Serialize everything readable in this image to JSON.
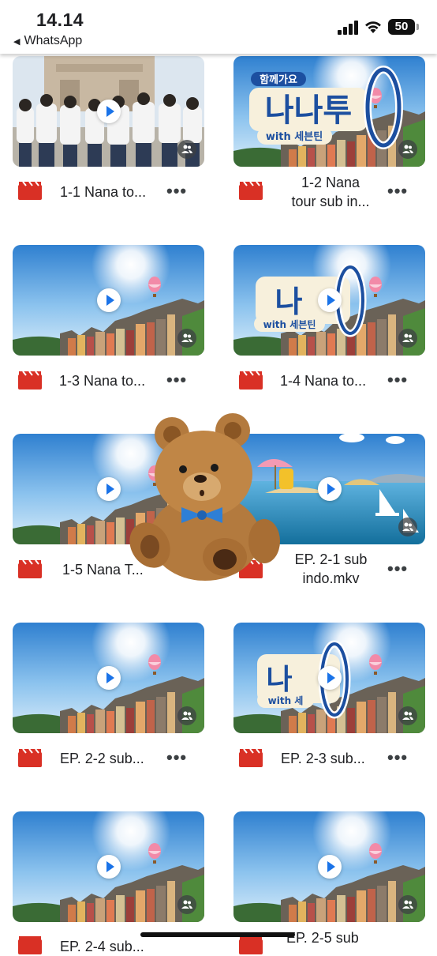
{
  "status_bar": {
    "time": "14.14",
    "back_app": "WhatsApp",
    "battery": "50"
  },
  "files": [
    {
      "name": "1-1 Nana to...",
      "thumb": "group-photo"
    },
    {
      "name": "1-2 Nana tour sub in...",
      "name_line1": "1-2 Nana",
      "name_line2": "tour sub in...",
      "thumb": "logo-full"
    },
    {
      "name": "1-3 Nana to...",
      "thumb": "sky"
    },
    {
      "name": "1-4 Nana to...",
      "thumb": "logo-partial"
    },
    {
      "name": "1-5 Nana T...",
      "thumb": "sky"
    },
    {
      "name": "EP. 2-1 sub indo.mkv",
      "name_line1": "EP. 2-1 sub",
      "name_line2": "indo.mkv",
      "thumb": "sea"
    },
    {
      "name": "EP. 2-2 sub...",
      "thumb": "sky"
    },
    {
      "name": "EP. 2-3 sub...",
      "thumb": "logo-partial"
    },
    {
      "name": "EP. 2-4 sub...",
      "thumb": "sky"
    },
    {
      "name": "EP. 2-5 sub...",
      "name_line1": "EP. 2-5 sub",
      "thumb": "sky"
    }
  ],
  "logo_text": {
    "korean_top": "함께가요",
    "korean_main": "나나투",
    "with": "with 세븐틴"
  },
  "more_label": "•••",
  "colors": {
    "file_icon_red": "#d93025",
    "play_blue": "#1a73e8",
    "sky_top": "#3a8fd8",
    "sea": "#1e8ab6"
  }
}
